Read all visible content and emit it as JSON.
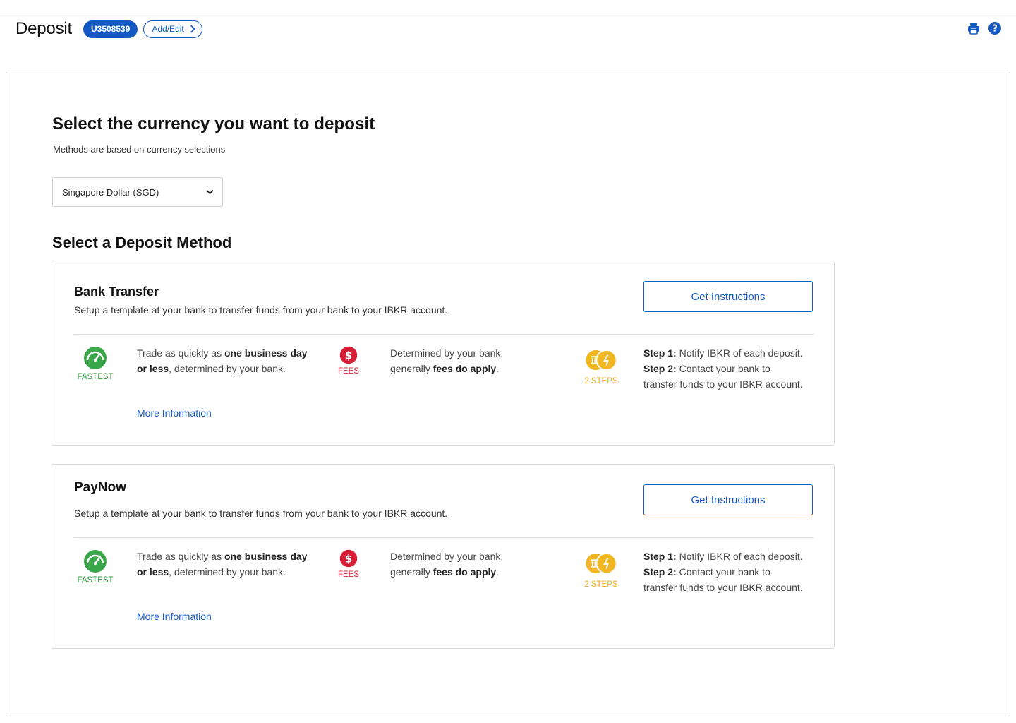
{
  "header": {
    "title": "Deposit",
    "account_id": "U3508539",
    "add_edit_label": "Add/Edit"
  },
  "currency_section": {
    "heading": "Select the currency you want to deposit",
    "subtext": "Methods are based on currency selections",
    "selected_currency": "Singapore Dollar (SGD)"
  },
  "method_section": {
    "heading": "Select a Deposit Method"
  },
  "methods": [
    {
      "title": "Bank Transfer",
      "description": "Setup a template at your bank to transfer funds from your bank to your IBKR account.",
      "button_label": "Get Instructions",
      "speed_label": "FASTEST",
      "speed_text_1": "Trade as quickly as ",
      "speed_bold_1": "one business day or less",
      "speed_text_2": ", determined by your bank.",
      "more_info_label": "More Information",
      "fees_label": "FEES",
      "fees_text_1": "Determined by your bank, generally ",
      "fees_bold": "fees do apply",
      "fees_text_2": ".",
      "steps_label": "2 STEPS",
      "step1_label": "Step 1:",
      "step1_text": " Notify IBKR of each deposit.",
      "step2_label": "Step 2:",
      "step2_text": " Contact your bank to transfer funds to your IBKR account."
    },
    {
      "title": "PayNow",
      "description": "Setup a template at your bank to transfer funds from your bank to your IBKR account.",
      "button_label": "Get Instructions",
      "speed_label": "FASTEST",
      "speed_text_1": "Trade as quickly as ",
      "speed_bold_1": "one business day or less",
      "speed_text_2": ", determined by your bank.",
      "more_info_label": "More Information",
      "fees_label": "FEES",
      "fees_text_1": "Determined by your bank, generally ",
      "fees_bold": "fees do apply",
      "fees_text_2": ".",
      "steps_label": "2 STEPS",
      "step1_label": "Step 1:",
      "step1_text": " Notify IBKR of each deposit.",
      "step2_label": "Step 2:",
      "step2_text": " Contact your bank to transfer funds to your IBKR account."
    }
  ],
  "colors": {
    "brand_blue": "#1559c4",
    "fastest_green": "#2a9a3a",
    "fees_red": "#d81e36",
    "steps_yellow": "#eaa814"
  },
  "icons": [
    "print-icon",
    "help-icon",
    "speedometer-icon",
    "dollar-icon",
    "bank-steps-icon",
    "chevron-right-icon",
    "chevron-down-icon"
  ]
}
